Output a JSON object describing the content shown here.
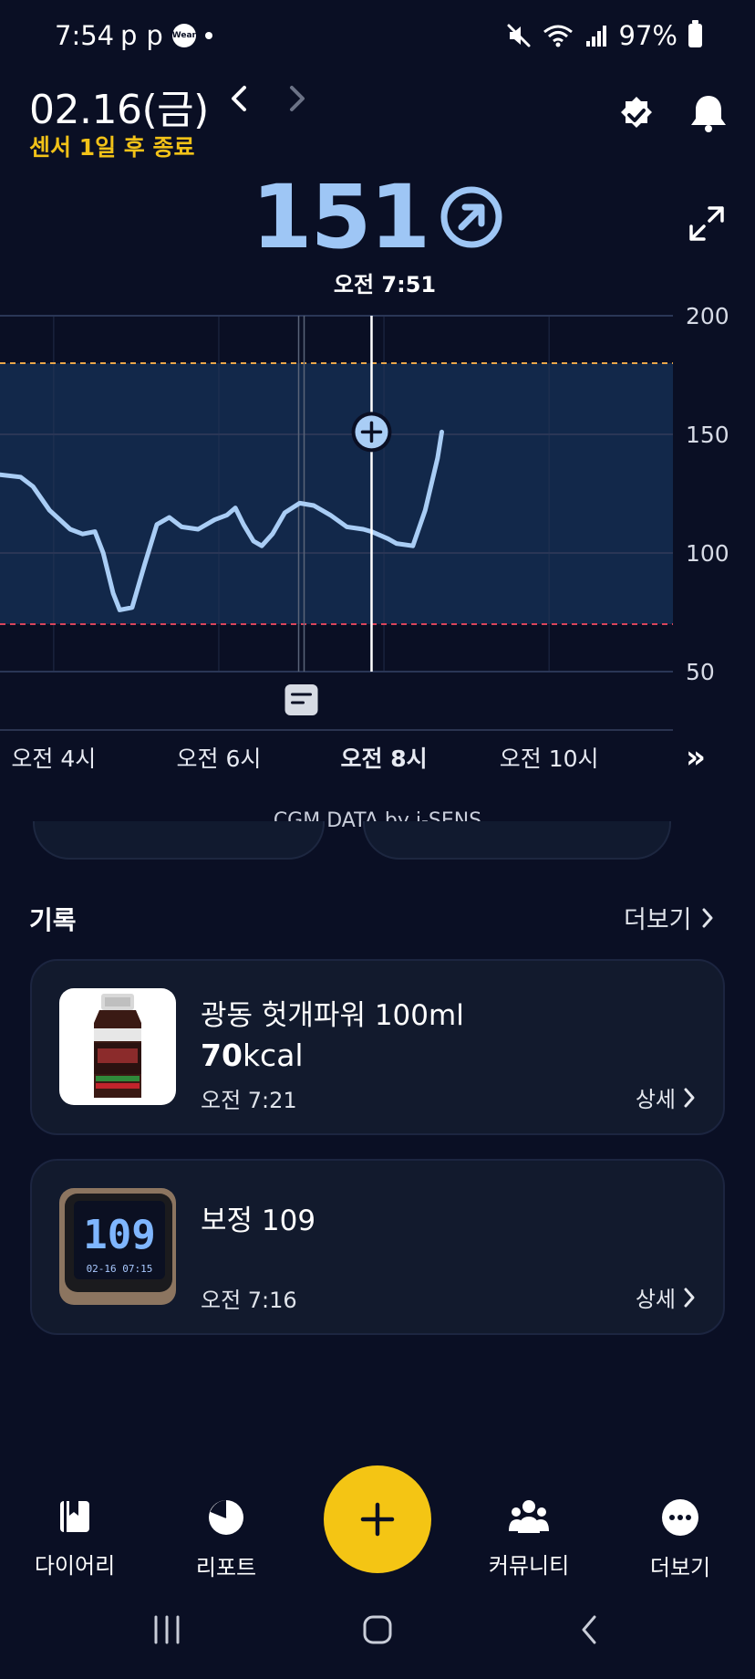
{
  "status_bar": {
    "time": "7:54",
    "app_icons": [
      "p",
      "p"
    ],
    "wear_badge": "Wear",
    "battery": "97%",
    "icons": [
      "mute-icon",
      "wifi-icon",
      "signal-icon",
      "battery-icon"
    ]
  },
  "header": {
    "date": "02.16(금)",
    "sensor_notice": "센서 1일 후 종료",
    "sensor_color": "#f2c218"
  },
  "glucose": {
    "value": "151",
    "trend_icon": "arrow-up-right-icon",
    "time": "오전 7:51",
    "color": "#9ec6f5"
  },
  "chart_data": {
    "type": "line",
    "y_ticks": [
      "200",
      "150",
      "100",
      "50"
    ],
    "ylim": [
      50,
      200
    ],
    "target_range": {
      "high": 180,
      "low": 70
    },
    "x_ticks": [
      "오전 4시",
      "오전 6시",
      "오전 8시",
      "오전 10시"
    ],
    "x_ticks_hours": [
      4,
      6,
      8,
      10
    ],
    "bold_tick": "오전 8시",
    "current": {
      "hour": 7.85,
      "value": 151
    },
    "note_marker_hour": 7.0,
    "series": [
      {
        "points": [
          [
            3.35,
            133
          ],
          [
            3.6,
            132
          ],
          [
            3.75,
            128
          ],
          [
            3.95,
            118
          ],
          [
            4.2,
            110
          ],
          [
            4.35,
            108
          ],
          [
            4.5,
            109
          ],
          [
            4.6,
            100
          ],
          [
            4.72,
            83
          ],
          [
            4.8,
            76
          ],
          [
            4.95,
            77
          ],
          [
            5.1,
            95
          ],
          [
            5.25,
            112
          ],
          [
            5.4,
            115
          ],
          [
            5.55,
            111
          ],
          [
            5.75,
            110
          ],
          [
            5.95,
            114
          ],
          [
            6.1,
            116
          ],
          [
            6.2,
            119
          ],
          [
            6.3,
            112
          ],
          [
            6.42,
            105
          ],
          [
            6.52,
            103
          ],
          [
            6.65,
            108
          ],
          [
            6.8,
            117
          ],
          [
            6.98,
            121
          ],
          [
            7.15,
            120
          ],
          [
            7.35,
            116
          ],
          [
            7.55,
            111
          ],
          [
            7.75,
            110
          ],
          [
            7.85,
            109
          ],
          [
            8.05,
            106
          ],
          [
            8.15,
            104
          ],
          [
            8.35,
            103
          ],
          [
            8.5,
            118
          ],
          [
            8.65,
            140
          ],
          [
            8.7,
            151
          ]
        ]
      }
    ]
  },
  "chart_colors": {
    "range_fill": "#12284a",
    "line": "#a9cdf5",
    "high_line": "#e9a64a",
    "low_line": "#d9445a",
    "grid": "#2a3656"
  },
  "cgm_credit": "CGM DATA by i-SENS",
  "records": {
    "title": "기록",
    "more_label": "더보기",
    "items": [
      {
        "title": "광동 헛개파워 100ml",
        "kcal_value": "70",
        "kcal_unit": "kcal",
        "time": "오전 7:21",
        "detail_label": "상세"
      },
      {
        "title": "보정 109",
        "time": "오전 7:16",
        "detail_label": "상세",
        "image_reading": "109",
        "image_date": "02-16 07:15"
      }
    ]
  },
  "bottom_nav": {
    "items": [
      {
        "label": "다이어리",
        "icon": "diary-icon"
      },
      {
        "label": "리포트",
        "icon": "report-icon"
      },
      {
        "label": "커뮤니티",
        "icon": "community-icon"
      },
      {
        "label": "더보기",
        "icon": "more-icon"
      }
    ],
    "fab_icon": "plus-icon",
    "fab_color": "#f4c514"
  },
  "system_nav": [
    "recent-apps-icon",
    "home-icon",
    "back-icon"
  ]
}
